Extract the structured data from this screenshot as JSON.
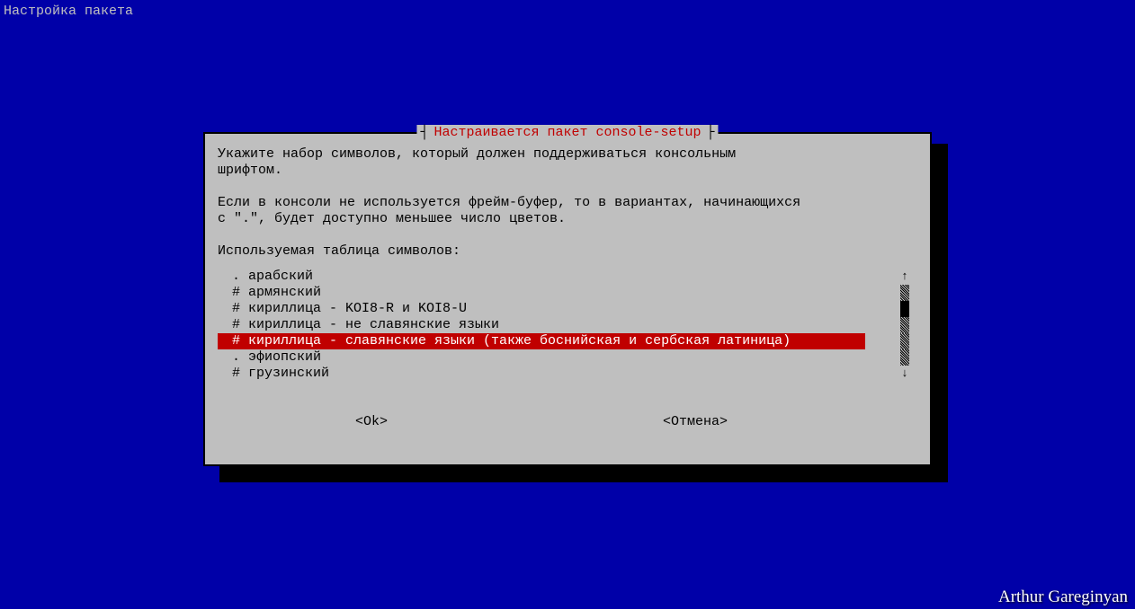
{
  "top_title": "Настройка пакета",
  "dialog": {
    "title": "Настраивается пакет console-setup",
    "prompt": "Укажите набор символов, который должен поддерживаться консольным\nшрифтом.\n\nЕсли в консоли не используется фрейм-буфер, то в вариантах, начинающихся\nс \".\", будет доступно меньшее число цветов.\n\nИспользуемая таблица символов:",
    "items": [
      ". арабский",
      "# армянский",
      "# кириллица - KOI8-R и KOI8-U",
      "# кириллица - не славянские языки",
      "# кириллица - славянские языки (также боснийская и сербская латиница)",
      ". эфиопский",
      "# грузинский"
    ],
    "selected_index": 4,
    "ok_label": "<Ok>",
    "cancel_label": "<Отмена>"
  },
  "watermark": "Arthur Gareginyan"
}
